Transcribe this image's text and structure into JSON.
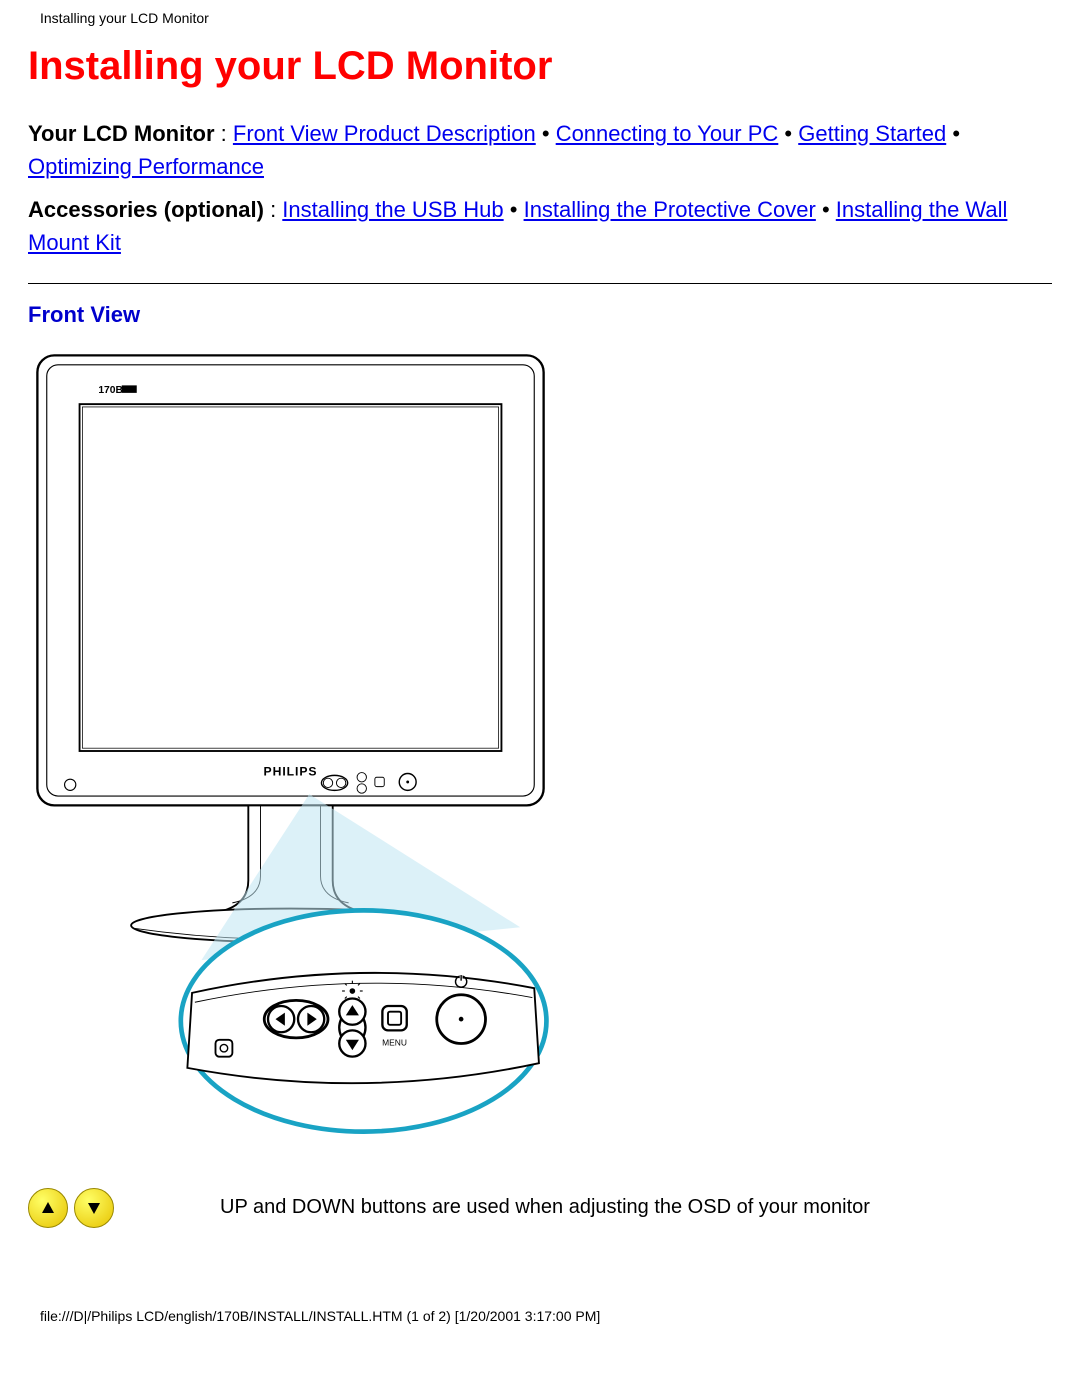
{
  "header": {
    "title": "Installing your LCD Monitor"
  },
  "page": {
    "title": "Installing your LCD Monitor"
  },
  "nav1": {
    "label": "Your LCD Monitor",
    "sep": " : ",
    "links": [
      "Front View Product Description",
      "Connecting to Your PC",
      "Getting Started",
      "Optimizing Performance"
    ]
  },
  "nav2": {
    "label": "Accessories (optional)",
    "sep": " : ",
    "links": [
      "Installing the USB Hub",
      "Installing the Protective Cover",
      "Installing the Wall Mount Kit"
    ]
  },
  "section": {
    "front_view": "Front View"
  },
  "diagram": {
    "model_label": "170B",
    "brand": "PHILIPS",
    "menu_label": "MENU"
  },
  "buttons": {
    "up_icon": "up-triangle",
    "down_icon": "down-triangle",
    "description": "UP and DOWN buttons are used when adjusting the OSD of your monitor"
  },
  "footer": {
    "text": "file:///D|/Philips LCD/english/170B/INSTALL/INSTALL.HTM (1 of 2) [1/20/2001 3:17:00 PM]"
  }
}
